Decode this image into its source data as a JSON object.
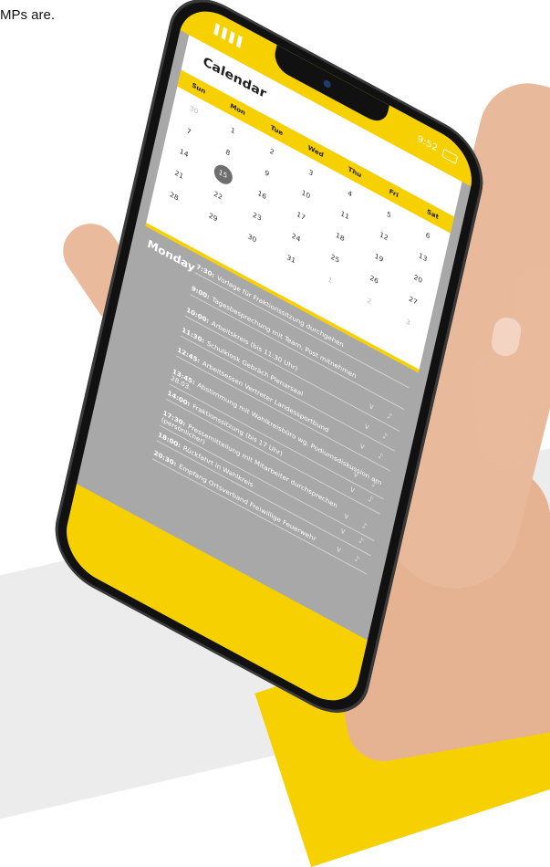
{
  "intro_text": "MPs are.",
  "status": {
    "signal": "▐▐▐▐",
    "time": "9:52"
  },
  "calendar": {
    "title": "Calendar",
    "weekdays": [
      "Sun",
      "Mon",
      "Tue",
      "Wed",
      "Thu",
      "Fri",
      "Sat"
    ],
    "rows": [
      [
        "30",
        "1",
        "2",
        "3",
        "4",
        "5",
        "6"
      ],
      [
        "7",
        "8",
        "9",
        "10",
        "11",
        "12",
        "13"
      ],
      [
        "14",
        "15",
        "16",
        "17",
        "18",
        "19",
        "20"
      ],
      [
        "21",
        "22",
        "23",
        "24",
        "25",
        "26",
        "27"
      ],
      [
        "28",
        "29",
        "30",
        "31",
        "1",
        "2",
        "3"
      ]
    ],
    "selected": "15"
  },
  "agenda": {
    "day": "Monday",
    "entries": [
      {
        "time": "7:30:",
        "text": "Vorlage für Fraktionssitzung durchgehen"
      },
      {
        "time": "9:00:",
        "text": "Tagesbesprechung mit Team, Post mitnehmen"
      },
      {
        "time": "10:00:",
        "text": "Arbeitskreis (bis 11:30 Uhr)"
      },
      {
        "time": "11:30:",
        "text": "Schulkiosk Gebräch Plenarsaal"
      },
      {
        "time": "12:45:",
        "text": "Arbeitsessen Vertreter Landessportbund"
      },
      {
        "time": "13:45:",
        "text": "Abstimmung mit Wahlkreisbüro wg. Podiumsdiskussion am 28.03."
      },
      {
        "time": "14:00:",
        "text": "Fraktionssitzung (bis 17 Uhr)"
      },
      {
        "time": "17:30:",
        "text": "Pressemitteilung mit Mitarbeiter durchsprechen (persönlicher)"
      },
      {
        "time": "18:00:",
        "text": "Rückfahrt in Wahlkreis"
      },
      {
        "time": "20:30:",
        "text": "Empfang Ortsverband Freiwillige Feuerwehr"
      }
    ]
  },
  "colors": {
    "accent": "#f7d000",
    "screen": "#a8a8a8"
  }
}
